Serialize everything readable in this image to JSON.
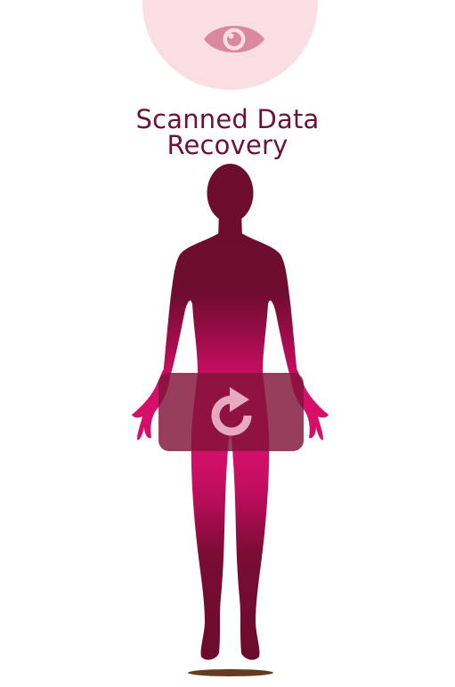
{
  "header": {
    "view_icon": "eye-icon",
    "circle_color": "#fbdde4"
  },
  "title": {
    "line1": "Scanned Data",
    "line2": "Recovery",
    "color": "#6d1136"
  },
  "figure": {
    "dark_color": "#6f0f2f",
    "bright_color": "#d80f6c"
  },
  "restore_button": {
    "icon": "rotate-clockwise-icon",
    "background": "#801438"
  }
}
